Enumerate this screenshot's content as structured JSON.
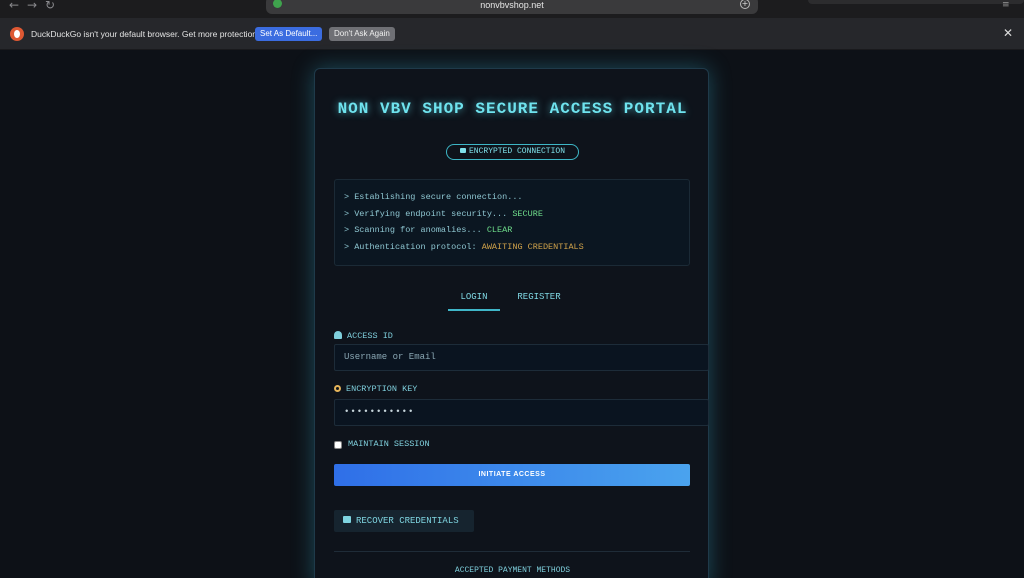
{
  "browser": {
    "url": "nonvbvshop.net",
    "back_icon": "arrow-left-icon",
    "forward_icon": "arrow-right-icon",
    "reload_icon": "reload-icon"
  },
  "notification": {
    "message": "DuckDuckGo isn't your default browser. Get more protection",
    "set_default_label": "Set As Default...",
    "dont_ask_label": "Don't Ask Again"
  },
  "portal": {
    "title": "NON VBV SHOP SECURE ACCESS PORTAL",
    "badge": "ENCRYPTED CONNECTION",
    "console": {
      "line1": "> Establishing secure connection...",
      "line2_prefix": "> Verifying endpoint security... ",
      "line2_status": "SECURE",
      "line3_prefix": "> Scanning for anomalies... ",
      "line3_status": "CLEAR",
      "line4_prefix": "> Authentication protocol: ",
      "line4_status": "AWAITING CREDENTIALS"
    },
    "tabs": {
      "login": "LOGIN",
      "register": "REGISTER"
    },
    "access_id": {
      "label": "ACCESS ID",
      "placeholder": "Username or Email"
    },
    "encryption_key": {
      "label": "ENCRYPTION KEY",
      "value": "•••••••••••"
    },
    "maintain_session": "MAINTAIN SESSION",
    "initiate_button": "INITIATE ACCESS",
    "recover_button": "RECOVER CREDENTIALS",
    "payments_heading": "ACCEPTED PAYMENT METHODS"
  },
  "colors": {
    "accent_cyan": "#6fe3ee",
    "status_ok": "#6fdd8b",
    "status_warn": "#d0a24a",
    "primary_button": "#2f6fe8"
  }
}
